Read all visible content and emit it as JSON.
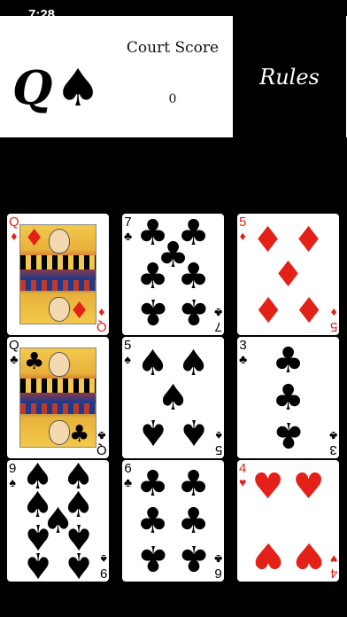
{
  "status_bar": {
    "time": "7:28"
  },
  "header": {
    "logo": {
      "rank": "Q",
      "suit": "♠"
    },
    "score_label": "Court Score",
    "score_value": "0",
    "rules_label": "Rules"
  },
  "cards": [
    {
      "rank": "Q",
      "suit": "♦",
      "color": "red",
      "face": true
    },
    {
      "rank": "7",
      "suit": "♣",
      "color": "black",
      "face": false
    },
    {
      "rank": "5",
      "suit": "♦",
      "color": "red",
      "face": false
    },
    {
      "rank": "Q",
      "suit": "♣",
      "color": "black",
      "face": true
    },
    {
      "rank": "5",
      "suit": "♠",
      "color": "black",
      "face": false
    },
    {
      "rank": "3",
      "suit": "♣",
      "color": "black",
      "face": false
    },
    {
      "rank": "9",
      "suit": "♠",
      "color": "black",
      "face": false
    },
    {
      "rank": "6",
      "suit": "♣",
      "color": "black",
      "face": false
    },
    {
      "rank": "4",
      "suit": "♥",
      "color": "red",
      "face": false
    }
  ],
  "colors": {
    "red_suit": "#e32119",
    "black_suit": "#000000",
    "background": "#000000"
  },
  "icons": {
    "logo_suit": "spade-icon"
  }
}
